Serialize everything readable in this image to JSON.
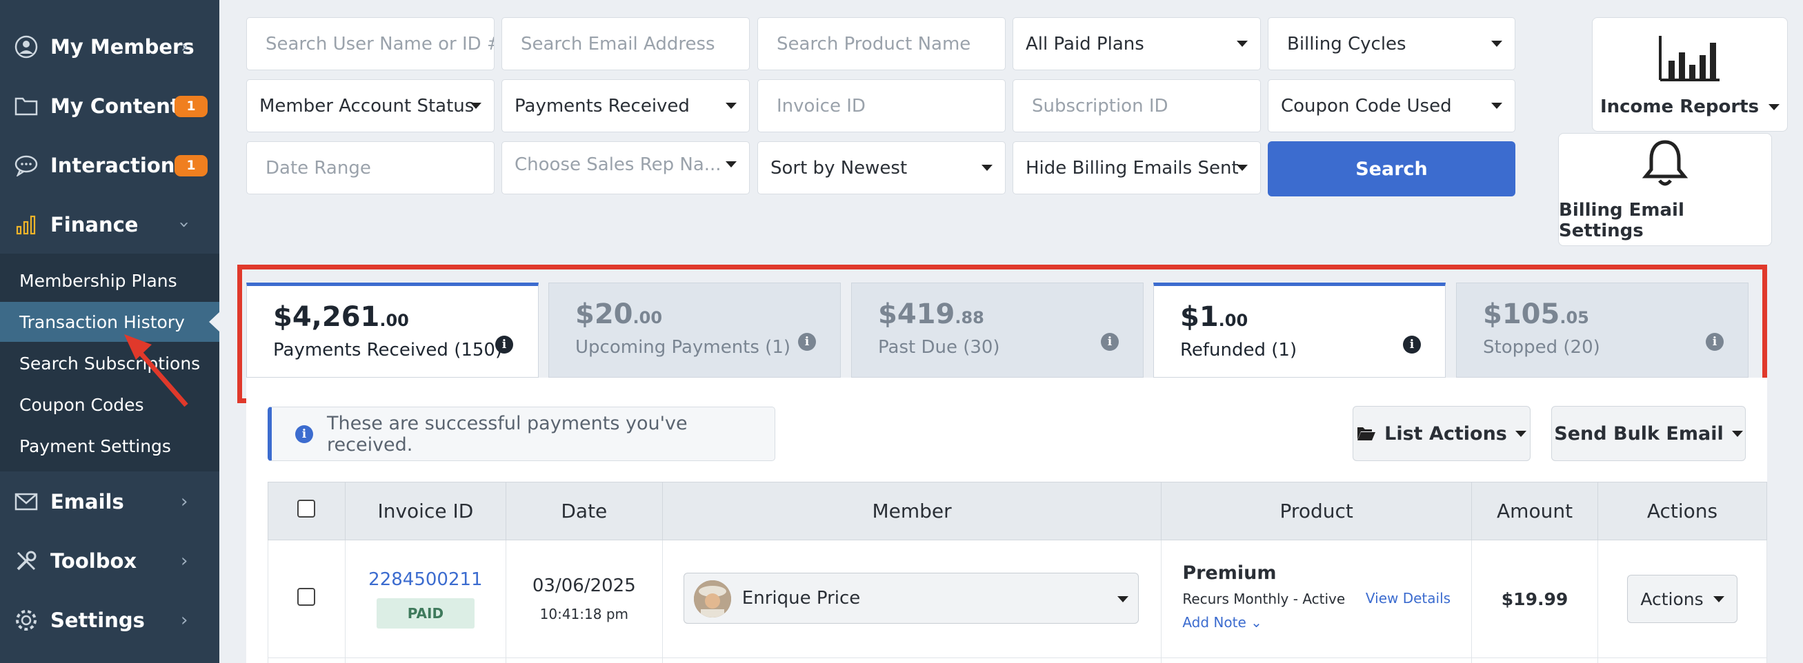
{
  "sidebar": {
    "items": [
      {
        "label": "My Members",
        "icon": "user-circle-icon"
      },
      {
        "label": "My Content",
        "icon": "folder-icon",
        "badge": "1"
      },
      {
        "label": "Interactions",
        "icon": "chat-bubble-icon",
        "badge": "1"
      },
      {
        "label": "Finance",
        "icon": "bar-chart-icon"
      },
      {
        "label": "Emails",
        "icon": "envelope-icon"
      },
      {
        "label": "Toolbox",
        "icon": "tools-icon"
      },
      {
        "label": "Settings",
        "icon": "gear-icon"
      }
    ],
    "finance_sub": [
      "Membership Plans",
      "Transaction History",
      "Search Subscriptions",
      "Coupon Codes",
      "Payment Settings"
    ]
  },
  "filters": {
    "user_placeholder": "Search User Name or ID #",
    "email_placeholder": "Search Email Address",
    "product_placeholder": "Search Product Name",
    "plans": "All Paid Plans",
    "billing_cycles": "Billing Cycles",
    "account_status": "Member Account Status",
    "payments": "Payments Received",
    "invoice_placeholder": "Invoice ID",
    "subscription_placeholder": "Subscription ID",
    "coupon": "Coupon Code Used",
    "date_placeholder": "Date Range",
    "sales_rep": "Choose Sales Rep Na...",
    "sort": "Sort by Newest",
    "billing_emails": "Hide Billing Emails Sent",
    "search_label": "Search"
  },
  "side_cards": {
    "income_reports": "Income Reports",
    "billing_email_settings": "Billing Email Settings"
  },
  "tabs": [
    {
      "amount": "$4,261",
      "cents": ".00",
      "label": "Payments Received (150)"
    },
    {
      "amount": "$20",
      "cents": ".00",
      "label": "Upcoming Payments (1)"
    },
    {
      "amount": "$419",
      "cents": ".88",
      "label": "Past Due (30)"
    },
    {
      "amount": "$1",
      "cents": ".00",
      "label": "Refunded (1)"
    },
    {
      "amount": "$105",
      "cents": ".05",
      "label": "Stopped (20)"
    }
  ],
  "notice": "These are successful payments you've received.",
  "list_actions": "List Actions",
  "send_bulk_email": "Send Bulk Email",
  "table": {
    "headers": [
      "Invoice ID",
      "Date",
      "Member",
      "Product",
      "Amount",
      "Actions"
    ],
    "rows": [
      {
        "invoice": "2284500211",
        "status": "PAID",
        "date": "03/06/2025",
        "time": "10:41:18 pm",
        "member": "Enrique Price",
        "product": "Premium",
        "recurs": "Recurs Monthly - Active",
        "add_note": "Add Note",
        "view_details": "View Details",
        "amount": "$19.99",
        "actions": "Actions"
      }
    ]
  },
  "colors": {
    "sidebar": "#2c3e50",
    "accent": "#3c6ccf",
    "highlight": "#e0392b",
    "badge": "#f07f1f"
  }
}
